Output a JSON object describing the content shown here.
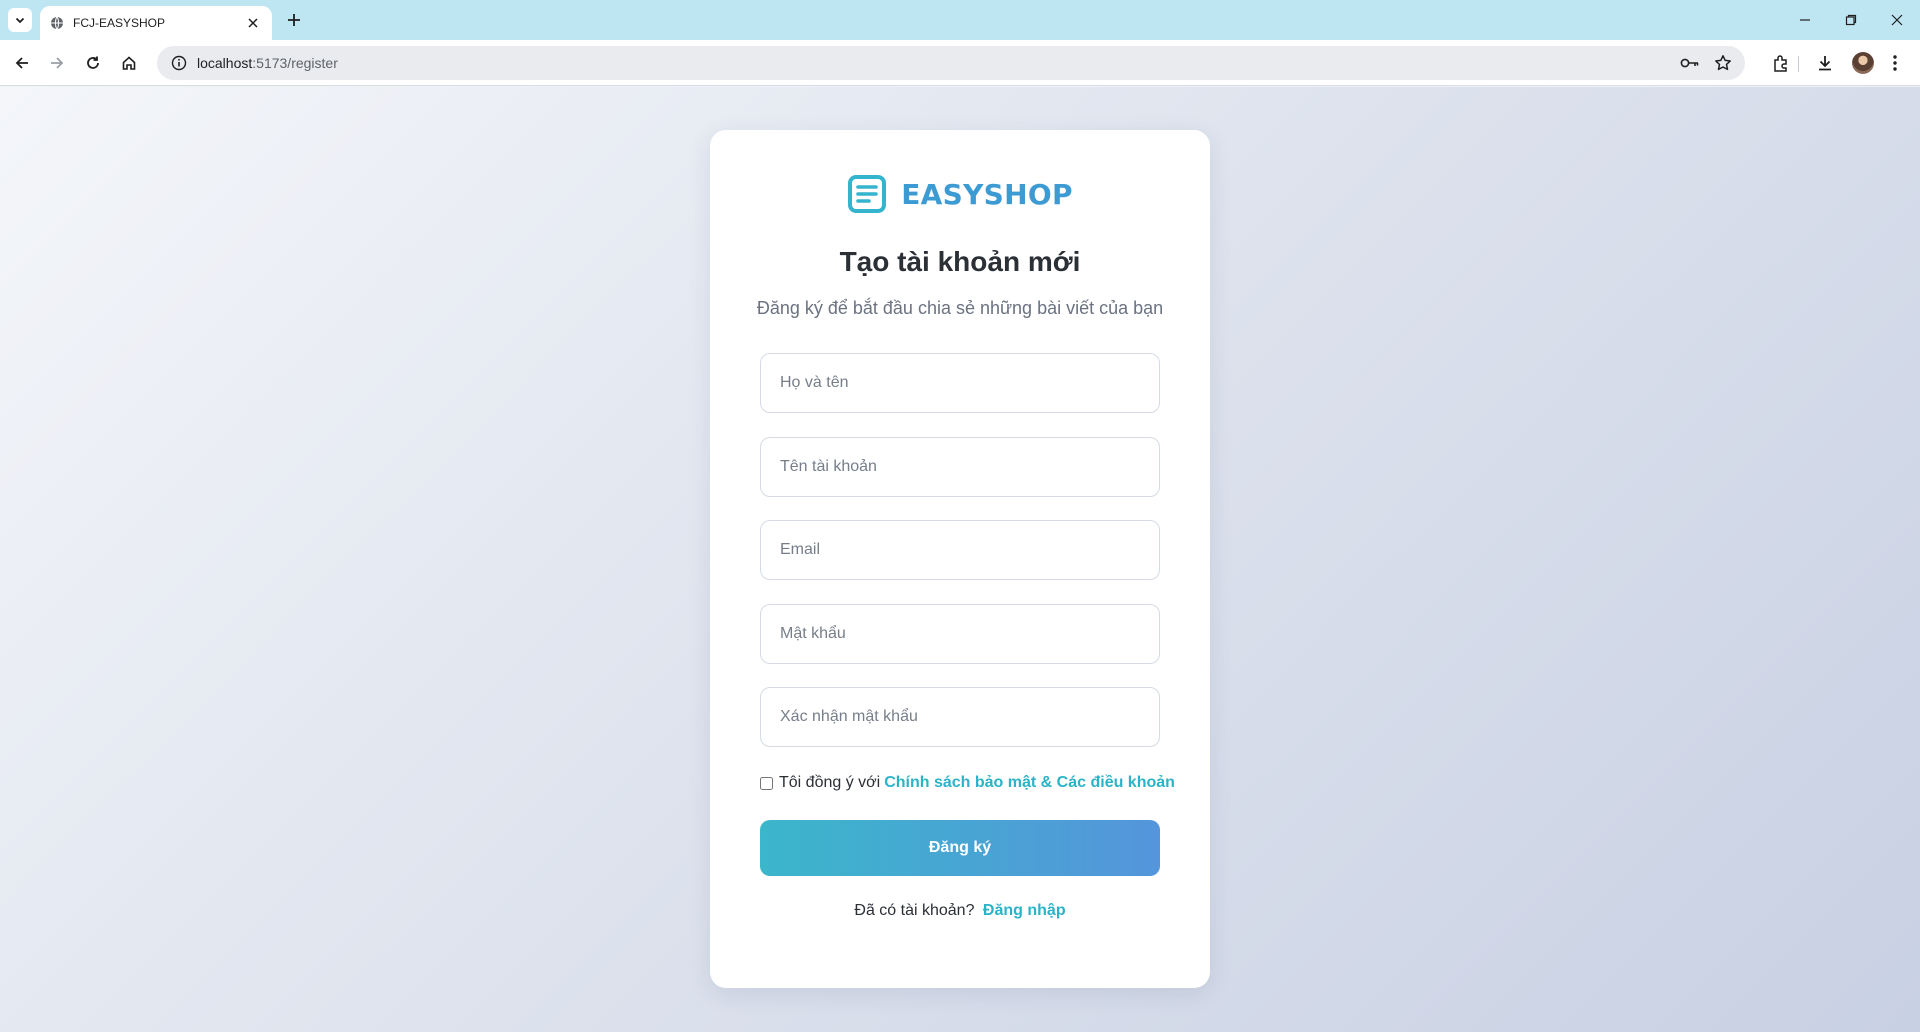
{
  "browser": {
    "tab_title": "FCJ-EASYSHOP",
    "url_host": "localhost",
    "url_path": ":5173/register"
  },
  "brand": {
    "name": "EASYSHOP",
    "color": "#3d9bd4"
  },
  "form": {
    "title": "Tạo tài khoản mới",
    "subtitle": "Đăng ký để bắt đầu chia sẻ những bài viết của bạn",
    "fullname_placeholder": "Họ và tên",
    "username_placeholder": "Tên tài khoản",
    "email_placeholder": "Email",
    "password_placeholder": "Mật khẩu",
    "confirm_placeholder": "Xác nhận mật khẩu",
    "agree_text": "Tôi đồng ý với",
    "agree_checked": false,
    "policy_link": "Chính sách bảo mật & Các điều khoản",
    "submit_label": "Đăng ký",
    "has_account_text": "Đã có tài khoản?",
    "login_link": "Đăng nhập",
    "accent_color": "#2bb3c8"
  }
}
